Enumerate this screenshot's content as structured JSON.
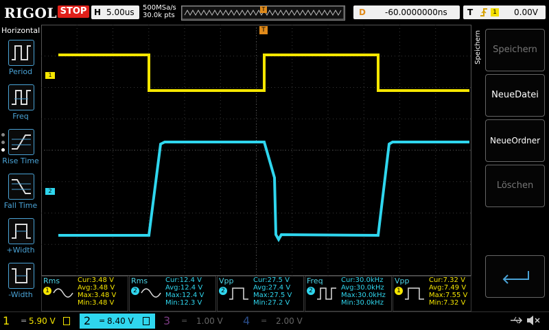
{
  "brand": "RIGOL",
  "run_state": "STOP",
  "horizontal": {
    "label": "H",
    "timebase": "5.00us"
  },
  "sample": {
    "rate": "500MSa/s",
    "points": "30.0k pts"
  },
  "delay": {
    "label": "D",
    "value": "-60.0000000ns"
  },
  "trigger": {
    "label": "T",
    "icon": "rising-edge-icon",
    "channel": "1",
    "level": "0.00V"
  },
  "left_menu": {
    "title": "Horizontal",
    "items": [
      {
        "label": "Period",
        "icon": "period-icon"
      },
      {
        "label": "Freq",
        "icon": "freq-icon"
      },
      {
        "label": "Rise Time",
        "icon": "rise-time-icon"
      },
      {
        "label": "Fall Time",
        "icon": "fall-time-icon"
      },
      {
        "label": "+Width",
        "icon": "pos-width-icon"
      },
      {
        "label": "-Width",
        "icon": "neg-width-icon"
      }
    ]
  },
  "right_menu": {
    "title": "Speichern",
    "items": [
      {
        "label": "Speichern",
        "enabled": false
      },
      {
        "label": "NeueDatei",
        "enabled": true
      },
      {
        "label": "NeueOrdner",
        "enabled": true
      },
      {
        "label": "Löschen",
        "enabled": false
      },
      {
        "label": "",
        "icon": "return-arrow-icon",
        "enabled": true
      }
    ]
  },
  "channel_markers": {
    "ch1": "1",
    "ch2": "2",
    "trigger_pos": "T"
  },
  "measurements": [
    {
      "name": "Rms",
      "channel": "1",
      "cur": "Cur:3.48 V",
      "avg": "Avg:3.48 V",
      "max": "Max:3.48 V",
      "min": "Min:3.48 V"
    },
    {
      "name": "Rms",
      "channel": "2",
      "cur": "Cur:12.4 V",
      "avg": "Avg:12.4 V",
      "max": "Max:12.4 V",
      "min": "Min:12.3 V"
    },
    {
      "name": "Vpp",
      "channel": "2",
      "cur": "Cur:27.5 V",
      "avg": "Avg:27.4 V",
      "max": "Max:27.5 V",
      "min": "Min:27.2 V"
    },
    {
      "name": "Freq",
      "channel": "2",
      "cur": "Cur:30.0kHz",
      "avg": "Avg:30.0kHz",
      "max": "Max:30.0kHz",
      "min": "Min:30.0kHz"
    },
    {
      "name": "Vpp",
      "channel": "1",
      "cur": "Cur:7.32 V",
      "avg": "Avg:7.49 V",
      "max": "Max:7.55 V",
      "min": "Min:7.32 V"
    }
  ],
  "channels": [
    {
      "num": "1",
      "scale": "5.90 V",
      "active": true
    },
    {
      "num": "2",
      "scale": "8.40 V",
      "active": true
    },
    {
      "num": "3",
      "scale": "1.00 V",
      "active": false
    },
    {
      "num": "4",
      "scale": "2.00 V",
      "active": false
    }
  ],
  "status_icons": [
    "usb-icon",
    "speaker-mute-icon"
  ],
  "colors": {
    "ch1": "#f5e600",
    "ch2": "#2fd6ee",
    "ch3": "#c43bd1",
    "ch4": "#2a6dd6",
    "accent": "#4aa3d6",
    "stop": "#e0201a"
  }
}
